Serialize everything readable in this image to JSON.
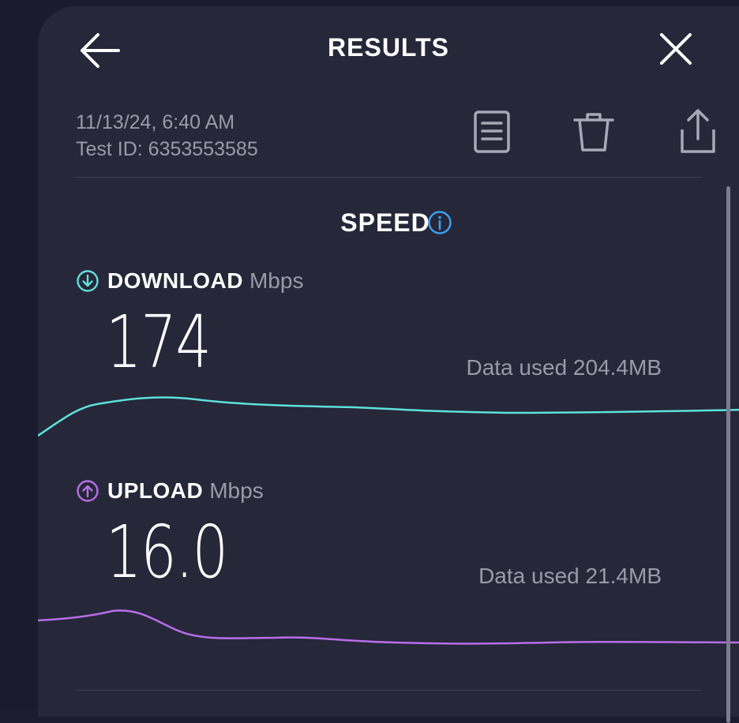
{
  "header": {
    "title": "RESULTS",
    "back_icon": "back-arrow-icon",
    "close_icon": "close-icon"
  },
  "meta": {
    "datetime": "11/13/24, 6:40 AM",
    "test_id": "Test ID: 6353553585"
  },
  "actions": [
    {
      "name": "details",
      "icon": "document-icon"
    },
    {
      "name": "delete",
      "icon": "trash-icon"
    },
    {
      "name": "share",
      "icon": "share-icon"
    }
  ],
  "speed": {
    "title": "SPEED",
    "info_icon": "info-icon"
  },
  "download": {
    "label": "DOWNLOAD",
    "unit": "Mbps",
    "value": "174",
    "data_used": "Data used 204.4MB",
    "color": "#5ee0dc"
  },
  "upload": {
    "label": "UPLOAD",
    "unit": "Mbps",
    "value": "16.0",
    "data_used": "Data used 21.4MB",
    "color": "#b86ee8"
  },
  "colors": {
    "background": "#1a1b2d",
    "sheet": "#262739",
    "text_primary": "#ffffff",
    "text_secondary": "#9a9aa8",
    "info_accent": "#3aa0f0"
  }
}
